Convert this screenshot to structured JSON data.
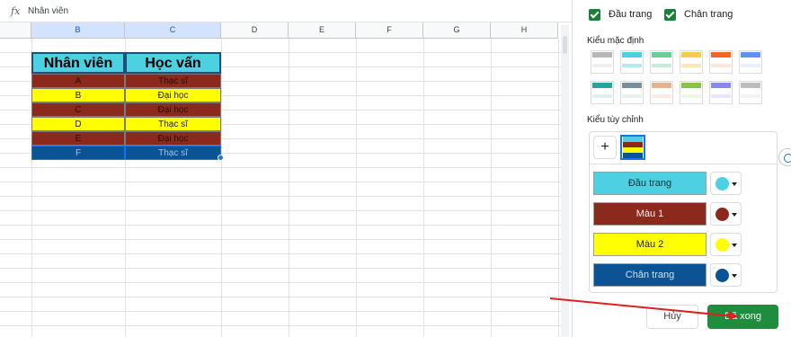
{
  "formula_bar": {
    "fx": "fx",
    "value": "Nhân viên"
  },
  "columns": [
    "B",
    "C",
    "D",
    "E",
    "F",
    "G",
    "H"
  ],
  "table": {
    "headers": [
      "Nhân viên",
      "Học vấn"
    ],
    "rows": [
      {
        "name": "A",
        "edu": "Thạc sĩ"
      },
      {
        "name": "B",
        "edu": "Đại học"
      },
      {
        "name": "C",
        "edu": "Đại học"
      },
      {
        "name": "D",
        "edu": "Thạc sĩ"
      },
      {
        "name": "E",
        "edu": "Đại học"
      },
      {
        "name": "F",
        "edu": "Thạc sĩ"
      }
    ]
  },
  "panel": {
    "header_checkbox": "Đầu trang",
    "footer_checkbox": "Chân trang",
    "default_styles_title": "Kiểu mặc định",
    "custom_styles_title": "Kiểu tùy chỉnh",
    "plus": "+",
    "color_rows": [
      {
        "label": "Đầu trang",
        "color": "#4dd0e1"
      },
      {
        "label": "Màu 1",
        "color": "#8b2a1c"
      },
      {
        "label": "Màu 2",
        "color": "#ffff00"
      },
      {
        "label": "Chân trang",
        "color": "#0b5394"
      }
    ],
    "cancel": "Hủy",
    "done": "Đã xong"
  },
  "colors": {
    "header": "#4dd0e1",
    "color1": "#8b2a1c",
    "color2": "#ffff00",
    "footer": "#0b5394",
    "accent": "#1a73e8",
    "done_button": "#1e8e3e"
  }
}
